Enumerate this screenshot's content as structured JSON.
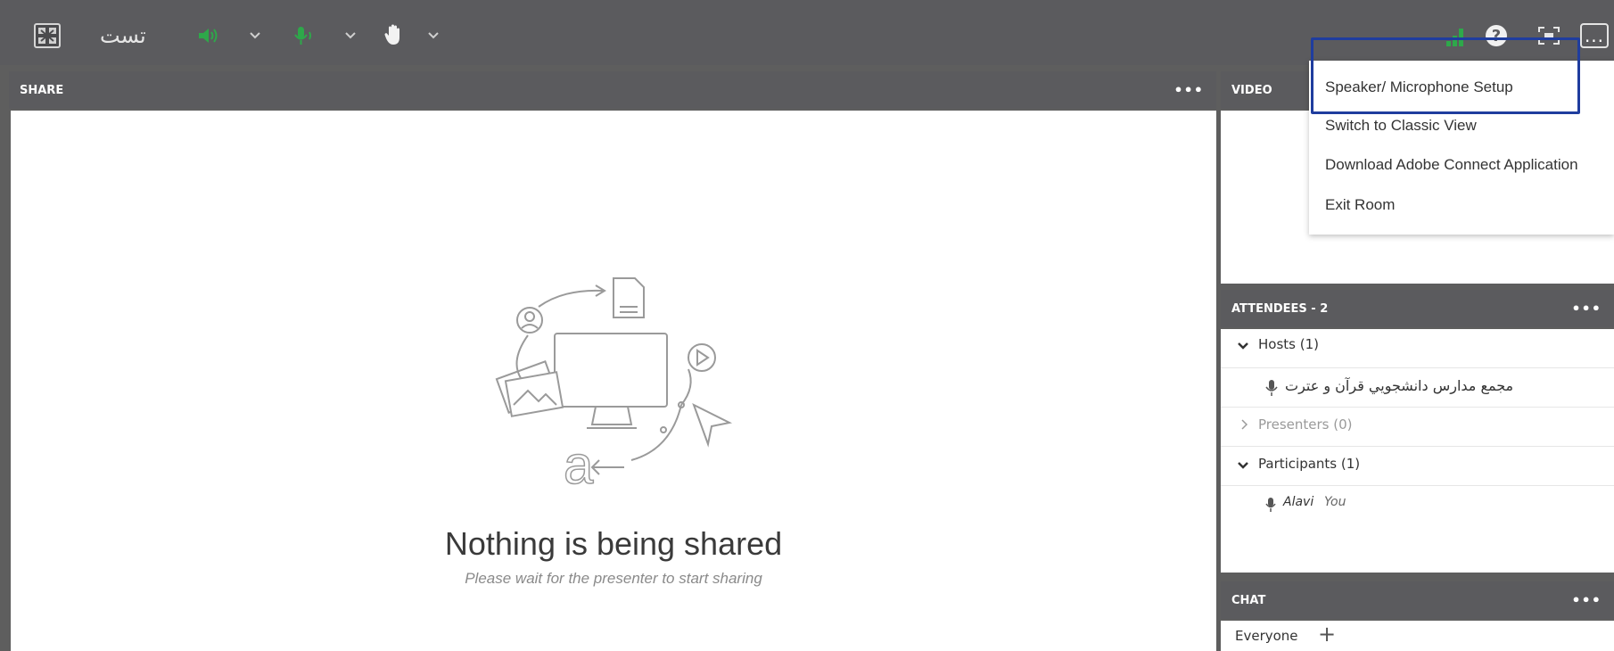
{
  "topbar": {
    "room_title": "تست",
    "layout_icon": "layout-grid-icon",
    "speaker_icon": "speaker-icon",
    "mic_icon": "microphone-icon",
    "hand_icon": "raise-hand-icon",
    "signal_icon": "connection-signal-icon",
    "help_icon": "help-icon",
    "help_glyph": "?",
    "fullscreen_icon": "fullscreen-icon",
    "more_label": "...",
    "accent_color": "#2ea84a"
  },
  "share_pod": {
    "title": "SHARE",
    "dots": "•••",
    "message_title": "Nothing is being shared",
    "message_subtitle": "Please wait for the presenter to start sharing"
  },
  "video_pod": {
    "title": "VIDEO"
  },
  "attendees_pod": {
    "title": "ATTENDEES - 2",
    "dots": "•••",
    "hosts_label": "Hosts (1)",
    "host_name": "مجمع مدارس دانشجويي قرآن و عترت",
    "presenters_label": "Presenters (0)",
    "participants_label": "Participants (1)",
    "participant_name": "Alavi",
    "participant_you": "You"
  },
  "chat_pod": {
    "title": "CHAT",
    "dots": "•••",
    "recipient": "Everyone",
    "add_label": "+"
  },
  "dropdown_menu": {
    "items": [
      "Speaker/ Microphone Setup",
      "Switch to Classic View",
      "Download Adobe Connect Application",
      "Exit Room"
    ],
    "highlight_color": "#1f3d9e"
  }
}
